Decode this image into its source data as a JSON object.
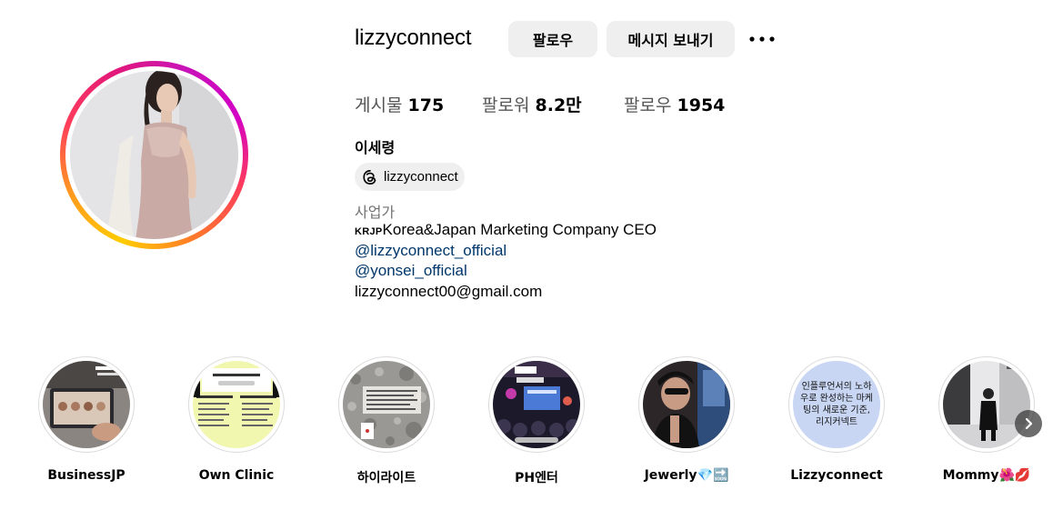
{
  "profile": {
    "username": "lizzyconnect",
    "follow_label": "팔로우",
    "message_label": "메시지 보내기",
    "stats": {
      "posts_label": "게시물",
      "posts_value": "175",
      "followers_label": "팔로워",
      "followers_value": "8.2만",
      "following_label": "팔로우",
      "following_value": "1954"
    },
    "display_name": "이세령",
    "threads_handle": "lizzyconnect",
    "category": "사업가",
    "bio_flag": "KRJP",
    "bio_line1": "Korea&Japan Marketing Company CEO",
    "bio_link1": "@lizzyconnect_official",
    "bio_link2": "@yonsei_official",
    "bio_email": "lizzyconnect00@gmail.com"
  },
  "highlights": [
    {
      "label": "BusinessJP",
      "icon": "laptop-photo"
    },
    {
      "label": "Own Clinic",
      "icon": "document-photo"
    },
    {
      "label": "하이라이트",
      "icon": "marble-photo"
    },
    {
      "label": "PH엔터",
      "icon": "stage-photo"
    },
    {
      "label": "Jewerly💎🔜",
      "icon": "portrait-photo"
    },
    {
      "label": "Lizzyconnect",
      "icon": "text-cover",
      "cover_text": "인플루언서의 노하우로 완성하는 마케팅의 새로운 기준, 리지커넥트"
    },
    {
      "label": "Mommy🌺💋",
      "icon": "street-photo"
    }
  ],
  "colors": {
    "button_bg": "#efefef",
    "link": "#00376b",
    "muted": "#737373"
  }
}
